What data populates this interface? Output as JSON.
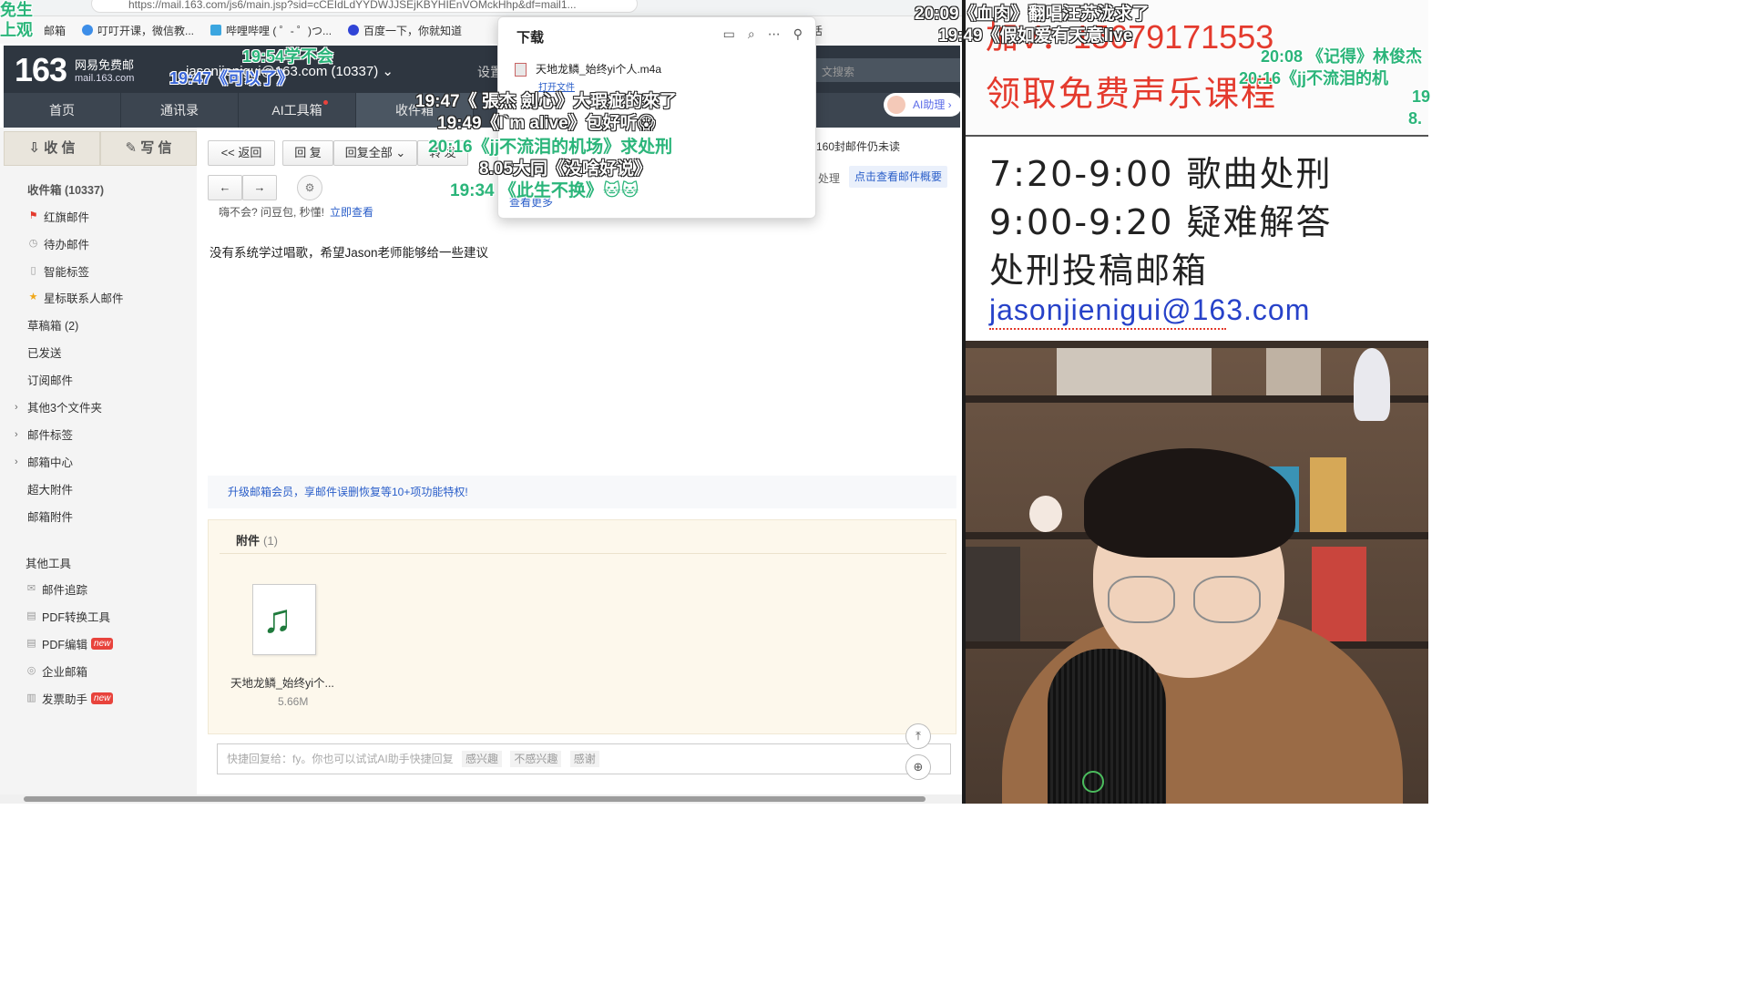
{
  "browser": {
    "address": "https://mail.163.com/js6/main.jsp?sid=cCEIdLdYYDWJJSEjKBYHIEnVOMckHhp&df=mail1...",
    "bookmarks": [
      "邮箱",
      "叮叮开课，微信教...",
      "哔哩哔哩 ( ゜- ゜)つ...",
      "百度一下，你就知道",
      "好生活"
    ]
  },
  "mail": {
    "logo_number": "163",
    "logo_text": "网易免费邮",
    "logo_domain": "mail.163.com",
    "account": "jasonjienigui@163.com (10337)",
    "settings": "设置",
    "search_placeholder": "文搜索",
    "nav_tabs": [
      "首页",
      "通讯录",
      "AI工具箱",
      "收件箱"
    ],
    "ai_helper": "AI助理",
    "receive": "收 信",
    "compose": "写 信",
    "folders": {
      "inbox": "收件箱 (10337)",
      "flagged": "红旗邮件",
      "todo": "待办邮件",
      "smart_tags": "智能标签",
      "starred": "星标联系人邮件",
      "drafts": "草稿箱 (2)",
      "sent": "已发送",
      "subscriptions": "订阅邮件",
      "other_folders": "其他3个文件夹",
      "mail_tags": "邮件标签",
      "mail_center": "邮箱中心",
      "large_attach": "超大附件",
      "mail_attach": "邮箱附件",
      "other_tools": "其他工具",
      "tracking": "邮件追踪",
      "pdf_convert": "PDF转换工具",
      "pdf_edit": "PDF编辑",
      "enterprise": "企业邮箱",
      "invoice": "发票助手",
      "new_badge": "new"
    },
    "toolbar": {
      "back": "<< 返回",
      "reply": "回 复",
      "reply_all": "回复全部",
      "forward": "转 发",
      "unread_note": "160封邮件仍未读",
      "process": "处理",
      "summary": "点击查看邮件概要"
    },
    "sub_hint": "嗨不会? 问豆包, 秒懂!",
    "sub_hint_link": "立即查看",
    "body": "没有系统学过唱歌，希望Jason老师能够给一些建议",
    "vip_bar": "升级邮箱会员，享邮件误删恢复等10+项功能特权!",
    "attachments_label": "附件",
    "attachments_count": "(1)",
    "file_name": "天地龙鳞_始终yi个...",
    "file_size": "5.66M",
    "quick_reply_placeholder": "快捷回复给：fy。你也可以试试AI助手快捷回复",
    "quick_reply_chips": [
      "感兴趣",
      "不感兴趣",
      "感谢"
    ]
  },
  "downloads": {
    "title": "下载",
    "item": "天地龙鳞_始终yi个人.m4a",
    "open_file": "打开文件",
    "more": "查看更多"
  },
  "stream": {
    "banner_number": "加V：15679171553",
    "banner_course": "领取免费声乐课程",
    "schedule": [
      "7:20-9:00  歌曲处刑",
      "9:00-9:20  疑难解答",
      "处刑投稿邮箱"
    ],
    "email": "jasonjienigui@163.com"
  },
  "danmaku": [
    {
      "text": "免生上观",
      "color": "green"
    },
    {
      "text": "19:54学不会",
      "color": "green"
    },
    {
      "text": "19:47《可以了》",
      "color": "blue"
    },
    {
      "text": "19:47《 張杰 劍心》大瑕疵的來了",
      "color": "white"
    },
    {
      "text": "19:49《I`m alive》包好听😱",
      "color": "white"
    },
    {
      "text": "20:16《jj不流泪的机场》求处刑",
      "color": "green"
    },
    {
      "text": "8.05大同《没啥好说》",
      "color": "white"
    },
    {
      "text": "19:34 《此生不换》🐱🐱",
      "color": "green"
    },
    {
      "text": "20:09《血肉》翻唱汪苏泷求了",
      "color": "white"
    },
    {
      "text": "19:49《假如爱有天意live",
      "color": "white"
    },
    {
      "text": "20:08 《记得》林俊杰",
      "color": "green"
    },
    {
      "text": "20:16《jj不流泪的机",
      "color": "green"
    },
    {
      "text": "19",
      "color": "green"
    },
    {
      "text": "8.",
      "color": "green"
    }
  ]
}
